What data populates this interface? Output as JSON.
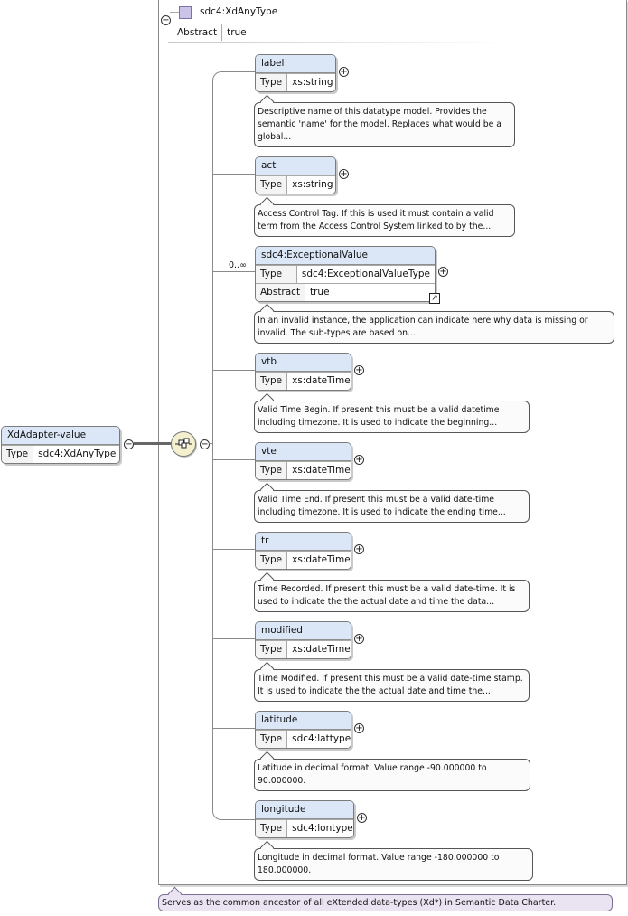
{
  "root": {
    "name": "XdAdapter-value",
    "type_label": "Type",
    "type_value": "sdc4:XdAnyType"
  },
  "complex_type": {
    "name": "sdc4:XdAnyType",
    "attr_label": "Abstract",
    "attr_value": "true"
  },
  "multiplicity": "0..∞",
  "elements": [
    {
      "name": "label",
      "type_label": "Type",
      "type_value": "xs:string",
      "note": "Descriptive name of this datatype model. Provides the semantic 'name' for the model. Replaces what would be a global..."
    },
    {
      "name": "act",
      "type_label": "Type",
      "type_value": "xs:string",
      "note": "Access Control Tag. If this is used it must contain a valid term from the Access Control System linked to by the..."
    },
    {
      "name": "sdc4:ExceptionalValue",
      "type_label": "Type",
      "type_value": "sdc4:ExceptionalValueType",
      "abstract_label": "Abstract",
      "abstract_value": "true",
      "note": "In an invalid instance, the application can indicate here why data is missing or invalid. The sub-types are based on..."
    },
    {
      "name": "vtb",
      "type_label": "Type",
      "type_value": "xs:dateTime",
      "note": "Valid Time Begin. If present this must be a valid datetime including timezone. It is used to indicate the beginning..."
    },
    {
      "name": "vte",
      "type_label": "Type",
      "type_value": "xs:dateTime",
      "note": "Valid Time End. If present this must be a valid date-time including timezone. It is used to indicate the ending time..."
    },
    {
      "name": "tr",
      "type_label": "Type",
      "type_value": "xs:dateTime",
      "note": "Time Recorded. If present this must be a valid date-time. It is used to indicate the the actual date and time the data..."
    },
    {
      "name": "modified",
      "type_label": "Type",
      "type_value": "xs:dateTime",
      "note": "Time Modified. If present this must be a valid date-time stamp. It is used to indicate the the actual date and time the..."
    },
    {
      "name": "latitude",
      "type_label": "Type",
      "type_value": "sdc4:lattype",
      "note": "Latitude in decimal format. Value range -90.000000 to 90.000000."
    },
    {
      "name": "longitude",
      "type_label": "Type",
      "type_value": "sdc4:lontype",
      "note": "Longitude in decimal format. Value range -180.000000 to 180.000000."
    }
  ],
  "footer_note": "Serves as the common ancestor of all eXtended data-types (Xd*) in Semantic Data Charter."
}
